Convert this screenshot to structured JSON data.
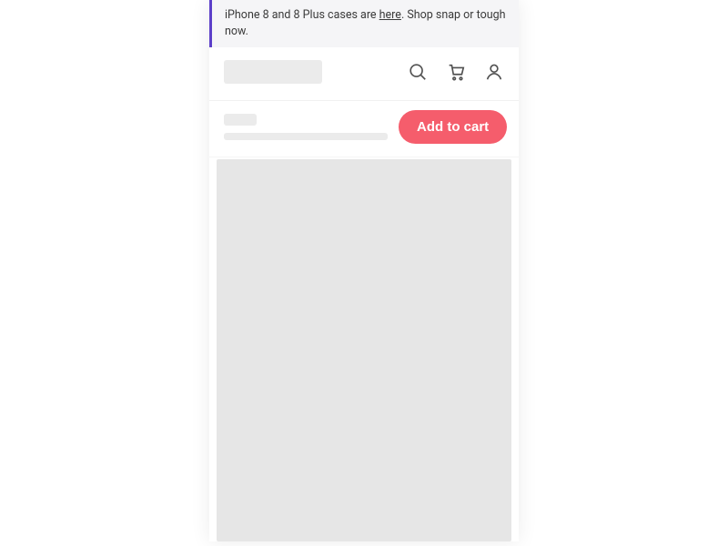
{
  "announcement": {
    "prefix": "iPhone 8 and 8 Plus cases are ",
    "link_text": "here",
    "suffix": ". Shop snap or tough now."
  },
  "header": {
    "icons": {
      "search": "search-icon",
      "cart": "cart-icon",
      "account": "account-icon"
    }
  },
  "product": {
    "add_to_cart_label": "Add to cart"
  }
}
